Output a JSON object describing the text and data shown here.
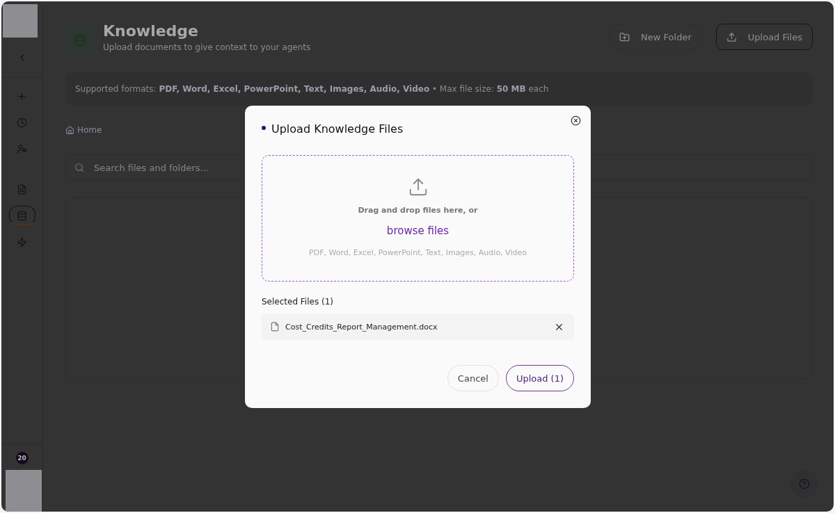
{
  "sidebar": {
    "items": [
      {
        "kind": "plus",
        "selected": false
      },
      {
        "kind": "clock",
        "selected": false
      },
      {
        "kind": "user",
        "selected": false
      },
      {
        "kind": "file",
        "selected": false
      },
      {
        "kind": "database",
        "selected": true
      },
      {
        "kind": "zap",
        "selected": false
      }
    ],
    "badge": "20"
  },
  "header": {
    "title": "Knowledge",
    "subtitle": "Upload documents to give context to your agents",
    "buttons": [
      {
        "label": "New Folder",
        "kind": "folder"
      },
      {
        "label": "Upload Files",
        "kind": "upload"
      }
    ]
  },
  "notice": "Supported formats: **PDF, Word, Excel, PowerPoint, Text, Images, Audio, Video** • Max file size: **50 MB** each",
  "breadcrumb": "Home",
  "search": {
    "placeholder": "Search files and folders..."
  },
  "dialog": {
    "title": "Upload Knowledge Files",
    "drop_text": "Drag and drop files here, or",
    "browse_link": "browse files",
    "formats": "PDF, Word, Excel, PowerPoint, Text, Images, Audio, Video",
    "selected_heading": "Selected Files (1)",
    "files": [
      {
        "name": "Cost_Credits_Report_Management.docx"
      }
    ],
    "cancel": "Cancel",
    "submit": "Upload (1)"
  }
}
